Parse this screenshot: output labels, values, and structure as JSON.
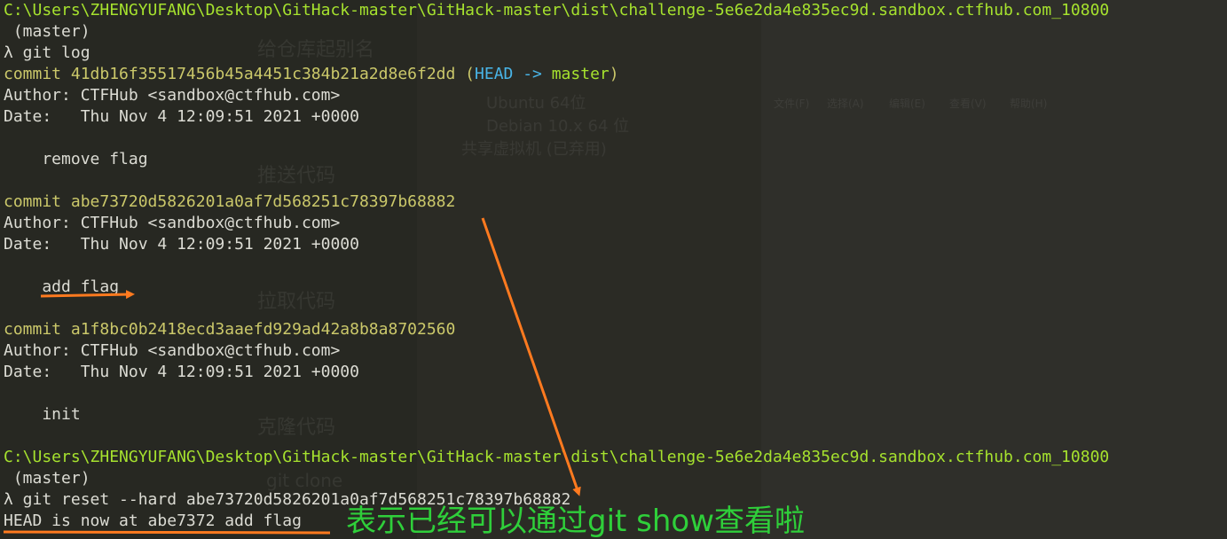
{
  "terminal": {
    "lines": [
      {
        "parts": [
          {
            "t": "C:\\Users\\ZHENGYUFANG\\Desktop\\GitHack-master\\GitHack-master\\dist\\challenge-5e6e2da4e835ec9d.sandbox.ctfhub.com_10800",
            "c": "green"
          }
        ]
      },
      {
        "parts": [
          {
            "t": " (master)",
            "c": "white"
          }
        ]
      },
      {
        "parts": [
          {
            "t": "λ git log",
            "c": "white"
          }
        ]
      },
      {
        "parts": [
          {
            "t": "commit 41db16f35517456b45a4451c384b21a2d8e6f2dd ",
            "c": "yellow"
          },
          {
            "t": "(",
            "c": "yellow"
          },
          {
            "t": "HEAD -> ",
            "c": "cyan"
          },
          {
            "t": "master",
            "c": "green"
          },
          {
            "t": ")",
            "c": "yellow"
          }
        ]
      },
      {
        "parts": [
          {
            "t": "Author: CTFHub <sandbox@ctfhub.com>",
            "c": "white"
          }
        ]
      },
      {
        "parts": [
          {
            "t": "Date:   Thu Nov 4 12:09:51 2021 +0000",
            "c": "white"
          }
        ]
      },
      {
        "parts": [
          {
            "t": "",
            "c": "white"
          }
        ]
      },
      {
        "parts": [
          {
            "t": "    remove flag",
            "c": "white"
          }
        ]
      },
      {
        "parts": [
          {
            "t": "",
            "c": "white"
          }
        ]
      },
      {
        "parts": [
          {
            "t": "commit abe73720d5826201a0af7d568251c78397b68882",
            "c": "yellow"
          }
        ]
      },
      {
        "parts": [
          {
            "t": "Author: CTFHub <sandbox@ctfhub.com>",
            "c": "white"
          }
        ]
      },
      {
        "parts": [
          {
            "t": "Date:   Thu Nov 4 12:09:51 2021 +0000",
            "c": "white"
          }
        ]
      },
      {
        "parts": [
          {
            "t": "",
            "c": "white"
          }
        ]
      },
      {
        "parts": [
          {
            "t": "    add flag",
            "c": "white"
          }
        ]
      },
      {
        "parts": [
          {
            "t": "",
            "c": "white"
          }
        ]
      },
      {
        "parts": [
          {
            "t": "commit a1f8bc0b2418ecd3aaefd929ad42a8b8a8702560",
            "c": "yellow"
          }
        ]
      },
      {
        "parts": [
          {
            "t": "Author: CTFHub <sandbox@ctfhub.com>",
            "c": "white"
          }
        ]
      },
      {
        "parts": [
          {
            "t": "Date:   Thu Nov 4 12:09:51 2021 +0000",
            "c": "white"
          }
        ]
      },
      {
        "parts": [
          {
            "t": "",
            "c": "white"
          }
        ]
      },
      {
        "parts": [
          {
            "t": "    init",
            "c": "white"
          }
        ]
      },
      {
        "parts": [
          {
            "t": "",
            "c": "white"
          }
        ]
      },
      {
        "parts": [
          {
            "t": "C:\\Users\\ZHENGYUFANG\\Desktop\\GitHack-master\\GitHack-master\\dist\\challenge-5e6e2da4e835ec9d.sandbox.ctfhub.com_10800",
            "c": "green"
          }
        ]
      },
      {
        "parts": [
          {
            "t": " (master)",
            "c": "white"
          }
        ]
      },
      {
        "parts": [
          {
            "t": "λ git reset --hard abe73720d5826201a0af7d568251c78397b68882",
            "c": "white"
          }
        ]
      },
      {
        "parts": [
          {
            "t": "HEAD is now at abe7372 add flag",
            "c": "white"
          }
        ]
      }
    ]
  },
  "annotation": {
    "text": "表示已经可以通过git show查看啦",
    "color": "#2fcf3a",
    "arrow_color": "#ff7a1f"
  },
  "background_windows": {
    "mid_texts": [
      "给仓库起别名",
      "推送代码",
      "拉取代码",
      "克隆代码",
      "Ubuntu 64位",
      "Debian 10.x 64 位",
      "共享虚拟机 (已弃用)",
      "git clone"
    ],
    "right_menu": [
      "文件(F)",
      "选择(A)",
      "编辑(E)",
      "查看(V)",
      "帮助(H)"
    ]
  },
  "colors": {
    "background": "#272822",
    "path_green": "#a6e22e",
    "commit_yellow": "#cbc86a",
    "head_cyan": "#49b5e8",
    "text": "#dcdcd4"
  }
}
